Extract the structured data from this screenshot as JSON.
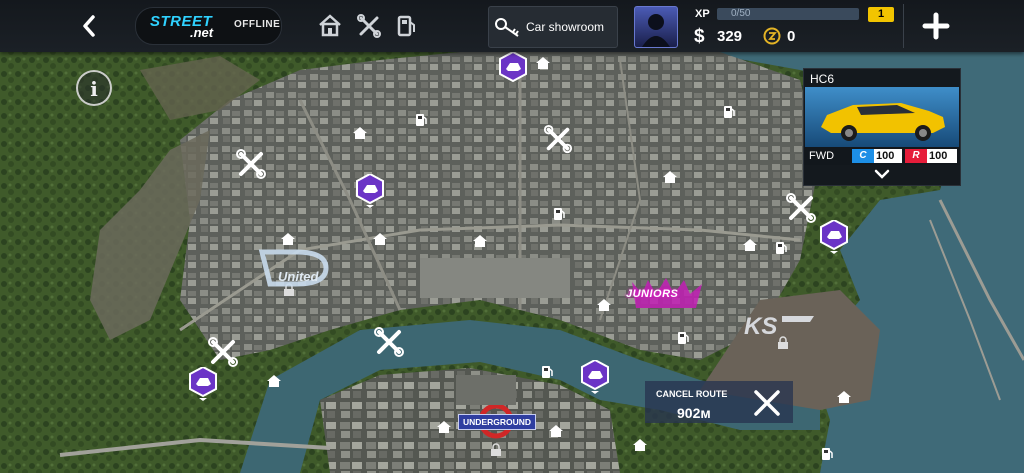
{
  "colors": {
    "accent_brand": "#2fd2ff",
    "xp_level_badge": "#f2c400",
    "race_marker": "#6b34c6",
    "route_panel": "#283450",
    "rating_blue": "#1d8fe6",
    "rating_red": "#e61d3a"
  },
  "header": {
    "back_icon": "chevron-left-icon",
    "brand": {
      "logo_line1": "STREET",
      "logo_line2": ".net",
      "status": "OFFLINE"
    },
    "nav_icons": [
      "home-icon",
      "wrench-icon",
      "fuel-icon"
    ],
    "showroom_label": "Car showroom",
    "player": {
      "xp_label": "XP",
      "xp_text": "0/50",
      "xp_progress": 0,
      "level": "1",
      "money": "329",
      "gold": "0"
    },
    "plus_icon": "plus-icon"
  },
  "car_card": {
    "name": "HC6",
    "drive": "FWD",
    "rating_a_tag": "C",
    "rating_a": "100",
    "rating_b_tag": "R",
    "rating_b": "100",
    "body_color": "#f2c200",
    "expand_icon": "chevron-down-icon"
  },
  "map": {
    "district_labels": [
      "Juniors",
      "UNDERGROUND",
      "KS",
      "United"
    ],
    "route": {
      "label": "CANCEL ROUTE",
      "distance": "902м"
    }
  },
  "juniors_label": "JUNIORS",
  "underground_label": "UNDERGROUND"
}
